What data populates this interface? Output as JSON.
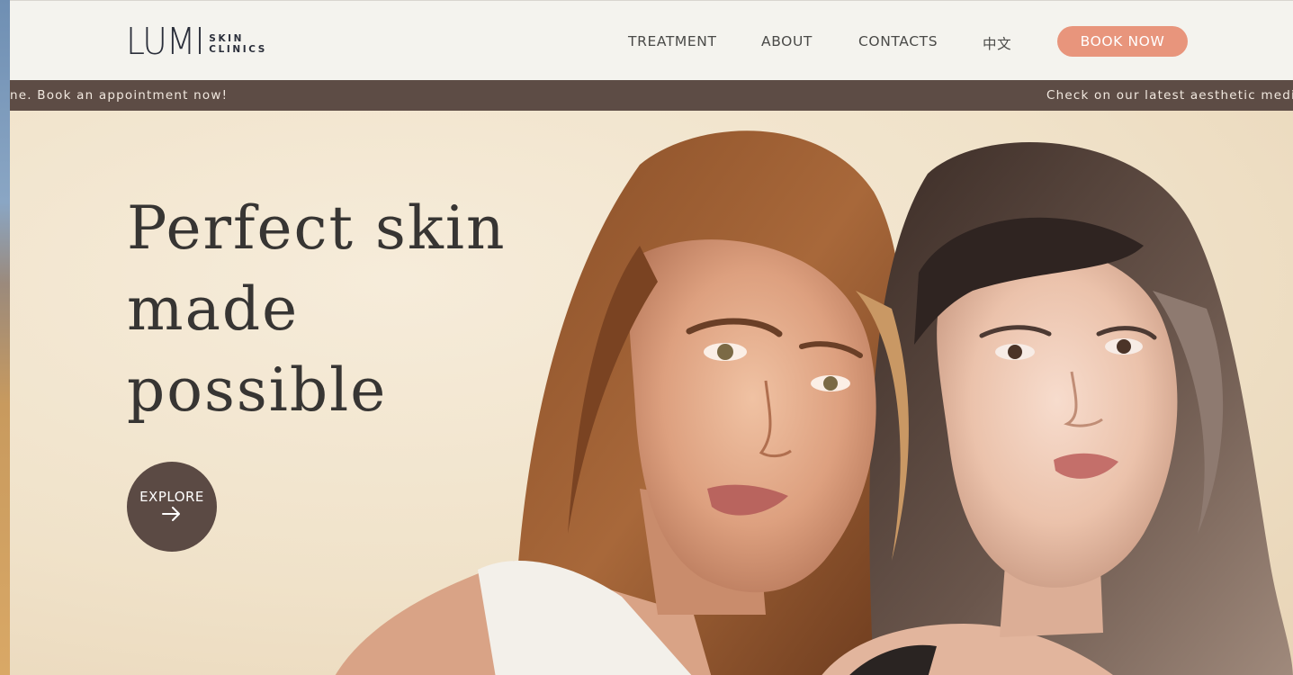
{
  "header": {
    "logo": {
      "word": "LUMI",
      "sub_line1": "SKIN",
      "sub_line2": "CLINICS"
    },
    "nav": [
      {
        "label": "TREATMENT"
      },
      {
        "label": "ABOUT"
      },
      {
        "label": "CONTACTS"
      },
      {
        "label": "中文"
      }
    ],
    "book_button": "BOOK NOW"
  },
  "marquee": {
    "text_left": "ne. Book an appointment now!",
    "text_right": "Check on our latest aesthetic medi"
  },
  "hero": {
    "title_lines": [
      "Perfect skin",
      "made",
      "possible"
    ],
    "explore_button": "EXPLORE"
  },
  "colors": {
    "accent": "#e8957c",
    "marquee_bg": "#5d4c45",
    "explore_bg": "#5b4a44",
    "header_bg": "#f4f3ee",
    "hero_bg": "#f0e2c9"
  },
  "icons": {
    "explore_arrow": "arrow-right-icon"
  }
}
